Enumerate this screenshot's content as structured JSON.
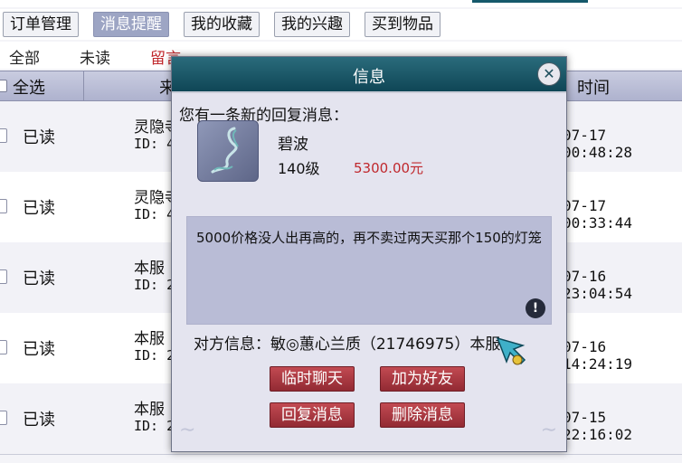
{
  "tabs": [
    {
      "label": "订单管理",
      "active": false
    },
    {
      "label": "消息提醒",
      "active": true
    },
    {
      "label": "我的收藏",
      "active": false
    },
    {
      "label": "我的兴趣",
      "active": false
    },
    {
      "label": "买到物品",
      "active": false
    }
  ],
  "filters": {
    "all": "全部",
    "unread": "未读",
    "message": "留言"
  },
  "table": {
    "headers": {
      "select_all": "全选",
      "from": "来",
      "time": "时间"
    },
    "rows": [
      {
        "status": "已读",
        "name": "灵隐寺",
        "id": "ID: 4",
        "time": "07-17 00:48:28"
      },
      {
        "status": "已读",
        "name": "灵隐寺",
        "id": "ID: 4",
        "time": "07-17 00:33:44"
      },
      {
        "status": "已读",
        "name": "本服",
        "id": "ID: 2",
        "time": "07-16 23:04:54"
      },
      {
        "status": "已读",
        "name": "本服",
        "id": "ID: 2",
        "time": "07-16 14:24:19"
      },
      {
        "status": "已读",
        "name": "本服",
        "id": "ID: 2",
        "time": "07-15 22:16:02"
      }
    ]
  },
  "dialog": {
    "title": "信息",
    "close_icon": "close-icon",
    "intro": "您有一条新的回复消息：",
    "item": {
      "name": "碧波",
      "level": "140级",
      "price": "5300.00元"
    },
    "message": "5000价格没人出再高的，再不卖过两天买那个150的灯笼",
    "peer_info": "对方信息：敏◎蕙心兰质（21746975）本服",
    "buttons": {
      "chat": "临时聊天",
      "add_friend": "加为好友",
      "reply": "回复消息",
      "delete": "删除消息"
    }
  },
  "colors": {
    "accent_teal": "#15596b",
    "price_red": "#c0282d",
    "button_red": "#a83540"
  }
}
